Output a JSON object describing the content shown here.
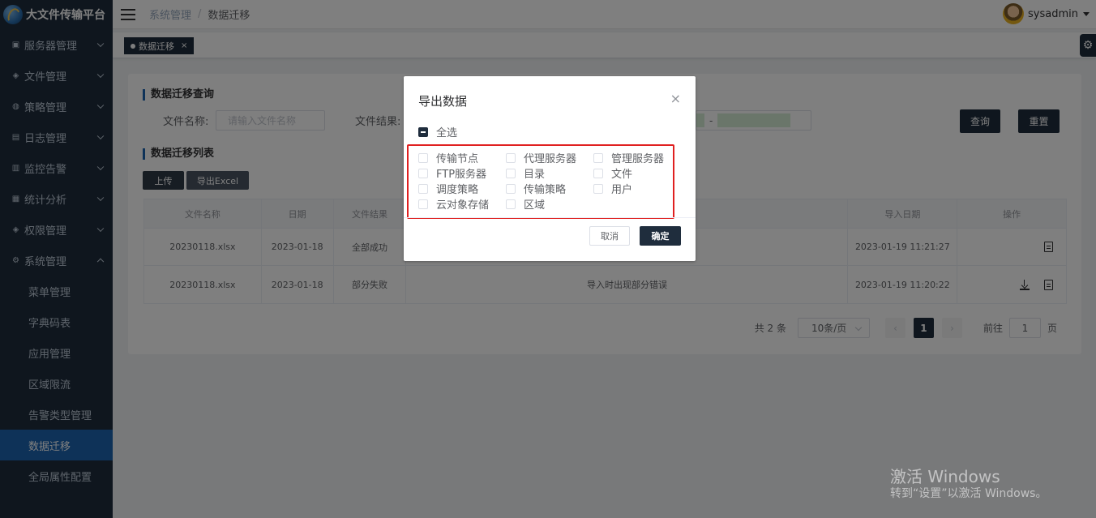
{
  "app": {
    "title": "大文件传输平台"
  },
  "sidebar": {
    "menus": [
      {
        "label": "服务器管理",
        "icon": "cube-icon"
      },
      {
        "label": "文件管理",
        "icon": "layers-icon"
      },
      {
        "label": "策略管理",
        "icon": "strategy-icon"
      },
      {
        "label": "日志管理",
        "icon": "log-icon"
      },
      {
        "label": "监控告警",
        "icon": "monitor-icon"
      },
      {
        "label": "统计分析",
        "icon": "stats-icon"
      },
      {
        "label": "权限管理",
        "icon": "permission-icon"
      },
      {
        "label": "系统管理",
        "icon": "gear-icon"
      }
    ],
    "sub_items": [
      "菜单管理",
      "字典码表",
      "应用管理",
      "区域限流",
      "告警类型管理",
      "数据迁移",
      "全局属性配置"
    ]
  },
  "header": {
    "breadcrumb": [
      "系统管理",
      "数据迁移"
    ],
    "separator": "/",
    "username": "sysadmin"
  },
  "tags": {
    "active": "数据迁移",
    "close": "×"
  },
  "query": {
    "title": "数据迁移查询",
    "file_name_label": "文件名称:",
    "file_name_placeholder": "请输入文件名称",
    "file_result_label": "文件结果:",
    "date_sep": "-",
    "search_btn": "查询",
    "reset_btn": "重置"
  },
  "list": {
    "title": "数据迁移列表",
    "upload_btn": "上传",
    "export_btn": "导出Excel",
    "columns": [
      "文件名称",
      "日期",
      "文件结果",
      "",
      "导入日期",
      "操作"
    ],
    "rows": [
      {
        "file": "20230118.xlsx",
        "date": "2023-01-18",
        "result": "全部成功",
        "desc": "",
        "import_date": "2023-01-19 11:21:27"
      },
      {
        "file": "20230118.xlsx",
        "date": "2023-01-18",
        "result": "部分失败",
        "desc": "导入时出现部分错误",
        "import_date": "2023-01-19 11:20:22"
      }
    ]
  },
  "pager": {
    "total": "共 2 条",
    "size": "10条/页",
    "prev": "‹",
    "page": "1",
    "next": "›",
    "goto": "前往",
    "goto_value": "1",
    "page_unit": "页"
  },
  "dialog": {
    "title": "导出数据",
    "close": "×",
    "select_all": "全选",
    "options": [
      "传输节点",
      "代理服务器",
      "管理服务器",
      "FTP服务器",
      "目录",
      "文件",
      "调度策略",
      "传输策略",
      "用户",
      "云对象存储",
      "区域"
    ],
    "cancel": "取消",
    "confirm": "确定"
  },
  "watermark": {
    "line1": "激活 Windows",
    "line2": "转到“设置”以激活 Windows。"
  },
  "colors": {
    "sidebar_bg": "#1f2d3d",
    "active_item": "#1d64b0",
    "highlight": "#e02020"
  }
}
